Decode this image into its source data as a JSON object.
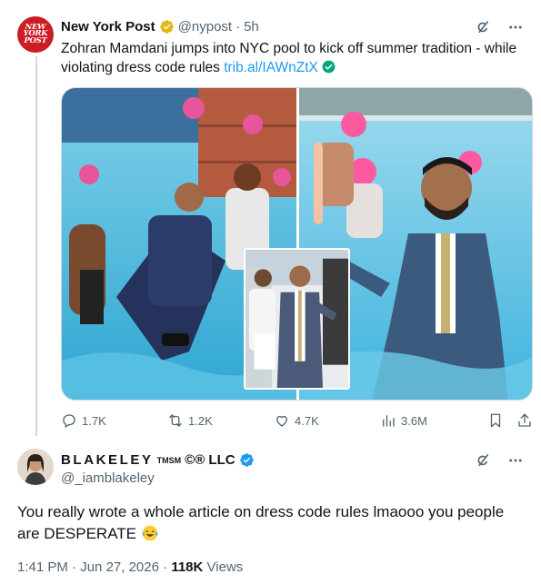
{
  "parent": {
    "avatar_text": "NEW\nYORK\nPOST",
    "name": "New York Post",
    "handle": "@nypost",
    "separator": "·",
    "time": "5h",
    "text": "Zohran Mamdani jumps into NYC pool to kick off summer tradition - while violating dress code rules ",
    "link": "trib.al/IAWnZtX",
    "metrics": {
      "replies": "1.7K",
      "reposts": "1.2K",
      "likes": "4.7K",
      "views": "3.6M"
    },
    "icons": [
      "grok-icon",
      "more-icon",
      "reply-icon",
      "repost-icon",
      "like-icon",
      "views-icon",
      "bookmark-icon",
      "share-icon"
    ]
  },
  "reply": {
    "name_main": "BLAKELEY",
    "name_marks": "TMSM",
    "name_rest": "©® LLC",
    "handle": "@_iamblakeley",
    "text": "You really wrote a whole article on dress code rules lmaooo you people are DESPERATE ",
    "time": "1:41 PM",
    "separator": "·",
    "date": "Jun 27, 2026",
    "views_count": "118K",
    "views_label": "Views"
  },
  "colors": {
    "accent": "#1d9bf0",
    "text": "#0f1419",
    "muted": "#536471",
    "brand_red": "#cc1c24",
    "gold_badge": "#e2b719"
  }
}
